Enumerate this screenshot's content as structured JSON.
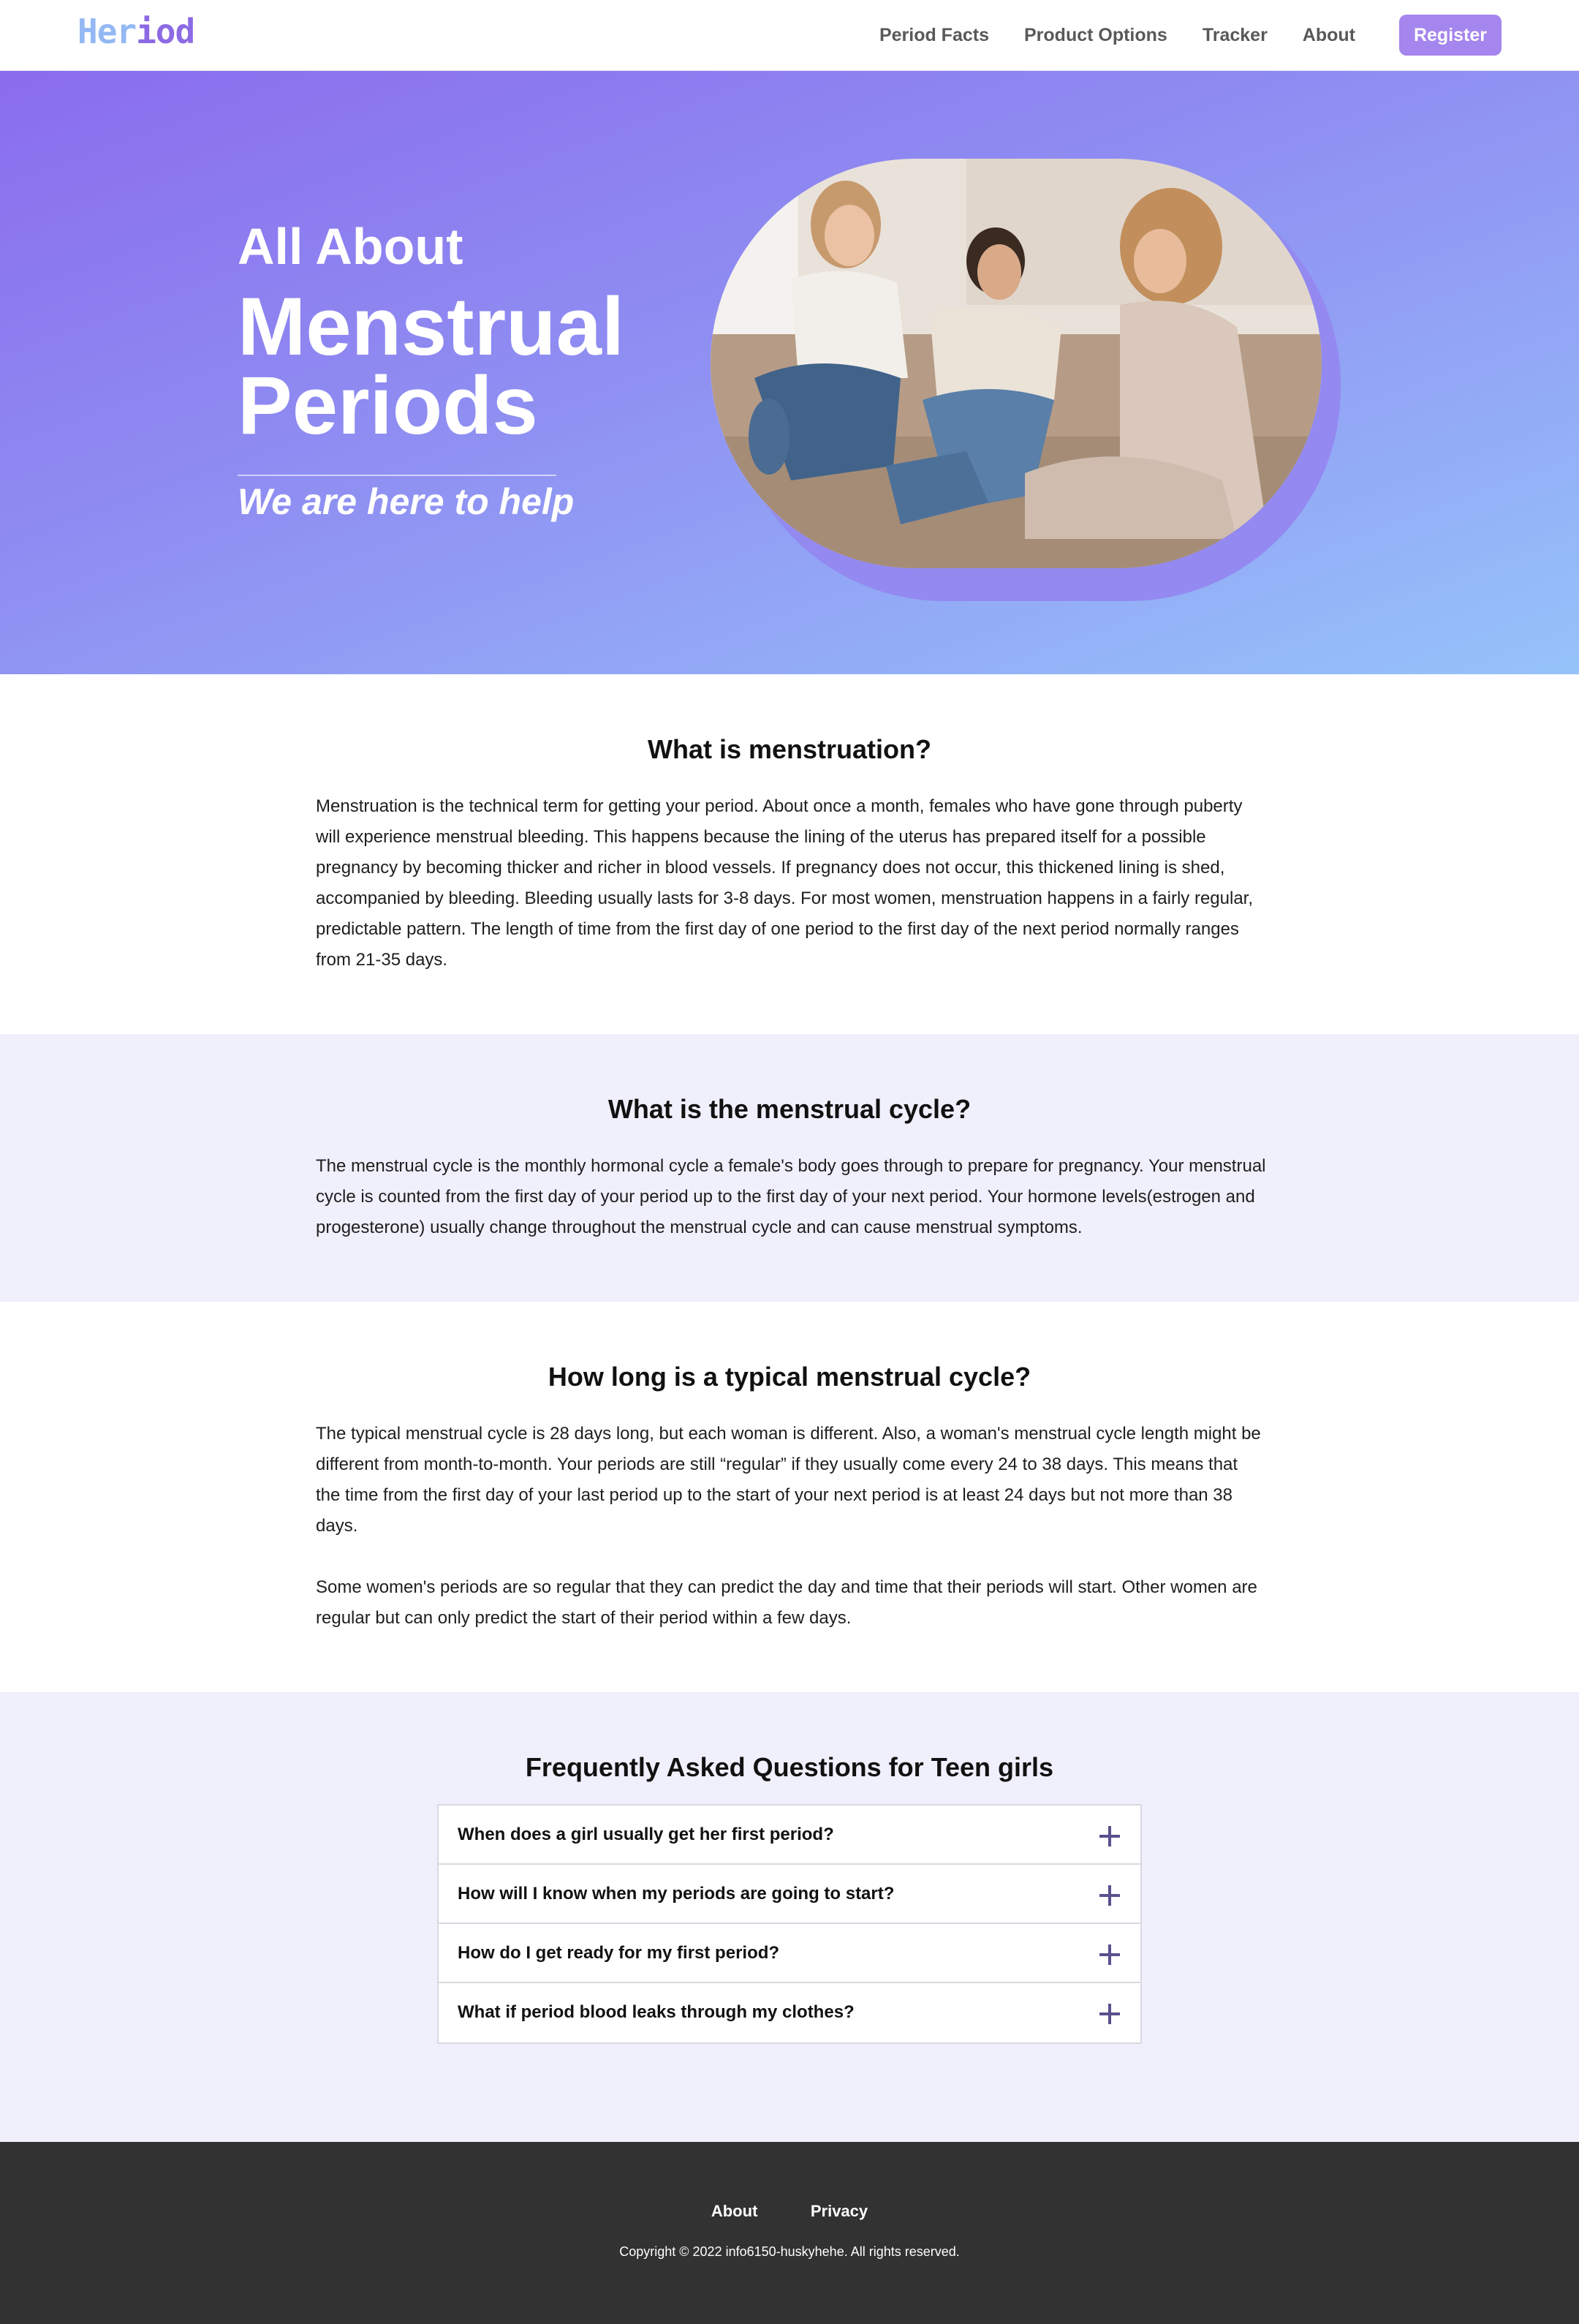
{
  "nav": {
    "logo_part1": "Her",
    "logo_part2": "iod",
    "links": [
      "Period Facts",
      "Product Options",
      "Tracker",
      "About"
    ],
    "register_label": "Register"
  },
  "hero": {
    "subtitle": "All About",
    "title_line1": "Menstrual",
    "title_line2": "Periods",
    "tagline": "We are here to help"
  },
  "sections": [
    {
      "heading": "What is menstruation?",
      "paragraphs": [
        "Menstruation is the technical term for getting your period. About once a month, females who have gone through puberty will experience menstrual bleeding. This happens because the lining of the uterus has prepared itself for a possible pregnancy by becoming thicker and richer in blood vessels. If pregnancy does not occur, this thickened lining is shed, accompanied by bleeding. Bleeding usually lasts for 3-8 days. For most women, menstruation happens in a fairly regular, predictable pattern. The length of time from the first day of one period to the first day of the next period normally ranges from 21-35 days."
      ]
    },
    {
      "heading": "What is the menstrual cycle?",
      "paragraphs": [
        "The menstrual cycle is the monthly hormonal cycle a female's body goes through to prepare for pregnancy. Your menstrual cycle is counted from the first day of your period up to the first day of your next period. Your hormone levels(estrogen and progesterone) usually change throughout the menstrual cycle and can cause menstrual symptoms."
      ]
    },
    {
      "heading": "How long is a typical menstrual cycle?",
      "paragraphs": [
        "The typical menstrual cycle is 28 days long, but each woman is different. Also, a woman's menstrual cycle length might be different from month-to-month. Your periods are still “regular” if they usually come every 24 to 38 days. This means that the time from the first day of your last period up to the start of your next period is at least 24 days but not more than 38 days.",
        "Some women's periods are so regular that they can predict the day and time that their periods will start. Other women are regular but can only predict the start of their period within a few days."
      ]
    }
  ],
  "faq": {
    "heading": "Frequently Asked Questions for Teen girls",
    "items": [
      "When does a girl usually get her first period?",
      "How will I know when my periods are going to start?",
      "How do I get ready for my first period?",
      "What if period blood leaks through my clothes?"
    ]
  },
  "footer": {
    "links": [
      "About",
      "Privacy"
    ],
    "copyright": "Copyright © 2022 info6150-huskyhehe. All rights reserved."
  },
  "colors": {
    "accent": "#a585ee",
    "hero_gradient_start": "#8a6ced",
    "hero_gradient_end": "#96c3fa",
    "alt_section_bg": "#f0effc",
    "footer_bg": "#323232"
  }
}
